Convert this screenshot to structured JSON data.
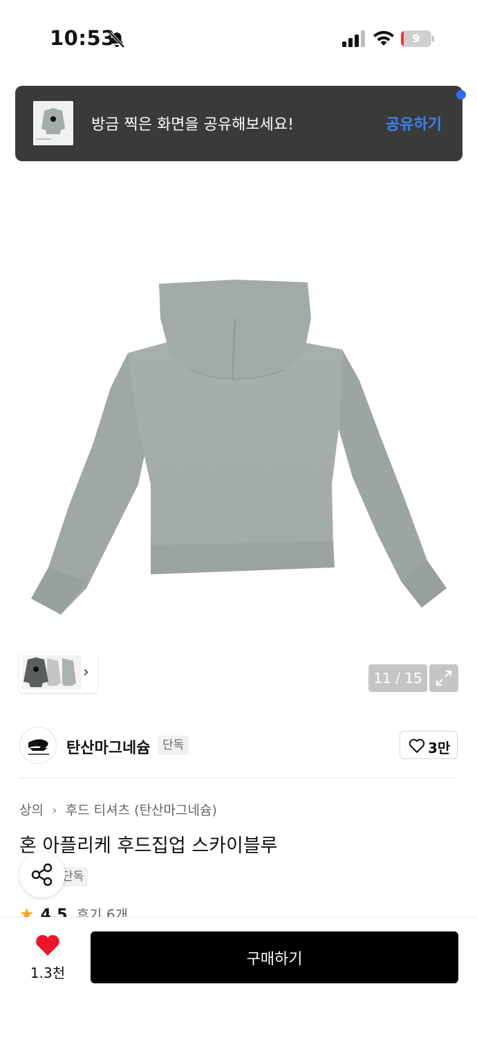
{
  "status_bar": {
    "time": "10:53",
    "battery_level": "9",
    "battery_percent": 9
  },
  "toast": {
    "message": "방금 찍은 화면을 공유해보세요!",
    "action_label": "공유하기",
    "action_color": "#3b82f6"
  },
  "gallery": {
    "counter": "11 / 15",
    "current": 11,
    "total": 15
  },
  "brand": {
    "name": "탄산마그네슘",
    "badge": "단독",
    "likes": "3만"
  },
  "breadcrumb": {
    "items": [
      "상의",
      "후드 티셔츠 (탄산마그네슘)"
    ]
  },
  "product": {
    "title": "혼 아플리케 후드집업 스카이블루",
    "badge": "단독",
    "rating": "4.5",
    "reviews": "후기 6개"
  },
  "bottom_bar": {
    "wish_count": "1.3천",
    "buy_label": "구매하기"
  },
  "colors": {
    "product": "#a9b2ae",
    "accent_red": "#e8152b",
    "star": "#f5a623",
    "buy_button": "#000000"
  },
  "icons": [
    "bell-slash-icon",
    "signal-icon",
    "wifi-icon",
    "battery-icon",
    "expand-icon",
    "heart-outline-icon",
    "share-icon",
    "star-icon",
    "heart-filled-icon",
    "chevron-right-icon"
  ]
}
